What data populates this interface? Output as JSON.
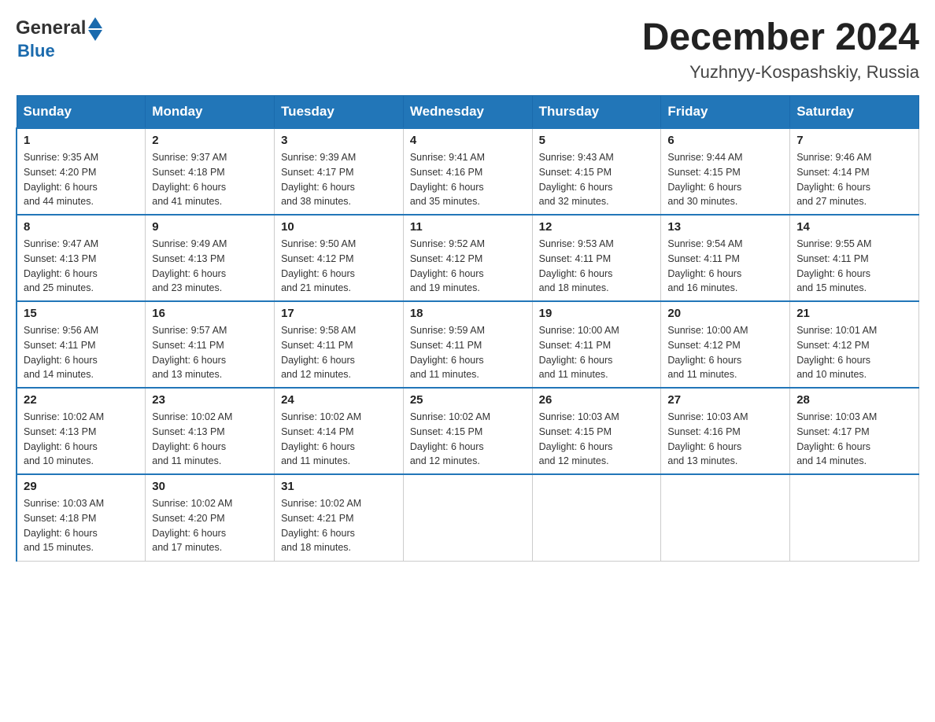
{
  "header": {
    "title": "December 2024",
    "subtitle": "Yuzhnyy-Kospashskiy, Russia",
    "logo_general": "General",
    "logo_blue": "Blue"
  },
  "days_of_week": [
    "Sunday",
    "Monday",
    "Tuesday",
    "Wednesday",
    "Thursday",
    "Friday",
    "Saturday"
  ],
  "weeks": [
    [
      {
        "day": "1",
        "sunrise": "Sunrise: 9:35 AM",
        "sunset": "Sunset: 4:20 PM",
        "daylight": "Daylight: 6 hours",
        "minutes": "and 44 minutes."
      },
      {
        "day": "2",
        "sunrise": "Sunrise: 9:37 AM",
        "sunset": "Sunset: 4:18 PM",
        "daylight": "Daylight: 6 hours",
        "minutes": "and 41 minutes."
      },
      {
        "day": "3",
        "sunrise": "Sunrise: 9:39 AM",
        "sunset": "Sunset: 4:17 PM",
        "daylight": "Daylight: 6 hours",
        "minutes": "and 38 minutes."
      },
      {
        "day": "4",
        "sunrise": "Sunrise: 9:41 AM",
        "sunset": "Sunset: 4:16 PM",
        "daylight": "Daylight: 6 hours",
        "minutes": "and 35 minutes."
      },
      {
        "day": "5",
        "sunrise": "Sunrise: 9:43 AM",
        "sunset": "Sunset: 4:15 PM",
        "daylight": "Daylight: 6 hours",
        "minutes": "and 32 minutes."
      },
      {
        "day": "6",
        "sunrise": "Sunrise: 9:44 AM",
        "sunset": "Sunset: 4:15 PM",
        "daylight": "Daylight: 6 hours",
        "minutes": "and 30 minutes."
      },
      {
        "day": "7",
        "sunrise": "Sunrise: 9:46 AM",
        "sunset": "Sunset: 4:14 PM",
        "daylight": "Daylight: 6 hours",
        "minutes": "and 27 minutes."
      }
    ],
    [
      {
        "day": "8",
        "sunrise": "Sunrise: 9:47 AM",
        "sunset": "Sunset: 4:13 PM",
        "daylight": "Daylight: 6 hours",
        "minutes": "and 25 minutes."
      },
      {
        "day": "9",
        "sunrise": "Sunrise: 9:49 AM",
        "sunset": "Sunset: 4:13 PM",
        "daylight": "Daylight: 6 hours",
        "minutes": "and 23 minutes."
      },
      {
        "day": "10",
        "sunrise": "Sunrise: 9:50 AM",
        "sunset": "Sunset: 4:12 PM",
        "daylight": "Daylight: 6 hours",
        "minutes": "and 21 minutes."
      },
      {
        "day": "11",
        "sunrise": "Sunrise: 9:52 AM",
        "sunset": "Sunset: 4:12 PM",
        "daylight": "Daylight: 6 hours",
        "minutes": "and 19 minutes."
      },
      {
        "day": "12",
        "sunrise": "Sunrise: 9:53 AM",
        "sunset": "Sunset: 4:11 PM",
        "daylight": "Daylight: 6 hours",
        "minutes": "and 18 minutes."
      },
      {
        "day": "13",
        "sunrise": "Sunrise: 9:54 AM",
        "sunset": "Sunset: 4:11 PM",
        "daylight": "Daylight: 6 hours",
        "minutes": "and 16 minutes."
      },
      {
        "day": "14",
        "sunrise": "Sunrise: 9:55 AM",
        "sunset": "Sunset: 4:11 PM",
        "daylight": "Daylight: 6 hours",
        "minutes": "and 15 minutes."
      }
    ],
    [
      {
        "day": "15",
        "sunrise": "Sunrise: 9:56 AM",
        "sunset": "Sunset: 4:11 PM",
        "daylight": "Daylight: 6 hours",
        "minutes": "and 14 minutes."
      },
      {
        "day": "16",
        "sunrise": "Sunrise: 9:57 AM",
        "sunset": "Sunset: 4:11 PM",
        "daylight": "Daylight: 6 hours",
        "minutes": "and 13 minutes."
      },
      {
        "day": "17",
        "sunrise": "Sunrise: 9:58 AM",
        "sunset": "Sunset: 4:11 PM",
        "daylight": "Daylight: 6 hours",
        "minutes": "and 12 minutes."
      },
      {
        "day": "18",
        "sunrise": "Sunrise: 9:59 AM",
        "sunset": "Sunset: 4:11 PM",
        "daylight": "Daylight: 6 hours",
        "minutes": "and 11 minutes."
      },
      {
        "day": "19",
        "sunrise": "Sunrise: 10:00 AM",
        "sunset": "Sunset: 4:11 PM",
        "daylight": "Daylight: 6 hours",
        "minutes": "and 11 minutes."
      },
      {
        "day": "20",
        "sunrise": "Sunrise: 10:00 AM",
        "sunset": "Sunset: 4:12 PM",
        "daylight": "Daylight: 6 hours",
        "minutes": "and 11 minutes."
      },
      {
        "day": "21",
        "sunrise": "Sunrise: 10:01 AM",
        "sunset": "Sunset: 4:12 PM",
        "daylight": "Daylight: 6 hours",
        "minutes": "and 10 minutes."
      }
    ],
    [
      {
        "day": "22",
        "sunrise": "Sunrise: 10:02 AM",
        "sunset": "Sunset: 4:13 PM",
        "daylight": "Daylight: 6 hours",
        "minutes": "and 10 minutes."
      },
      {
        "day": "23",
        "sunrise": "Sunrise: 10:02 AM",
        "sunset": "Sunset: 4:13 PM",
        "daylight": "Daylight: 6 hours",
        "minutes": "and 11 minutes."
      },
      {
        "day": "24",
        "sunrise": "Sunrise: 10:02 AM",
        "sunset": "Sunset: 4:14 PM",
        "daylight": "Daylight: 6 hours",
        "minutes": "and 11 minutes."
      },
      {
        "day": "25",
        "sunrise": "Sunrise: 10:02 AM",
        "sunset": "Sunset: 4:15 PM",
        "daylight": "Daylight: 6 hours",
        "minutes": "and 12 minutes."
      },
      {
        "day": "26",
        "sunrise": "Sunrise: 10:03 AM",
        "sunset": "Sunset: 4:15 PM",
        "daylight": "Daylight: 6 hours",
        "minutes": "and 12 minutes."
      },
      {
        "day": "27",
        "sunrise": "Sunrise: 10:03 AM",
        "sunset": "Sunset: 4:16 PM",
        "daylight": "Daylight: 6 hours",
        "minutes": "and 13 minutes."
      },
      {
        "day": "28",
        "sunrise": "Sunrise: 10:03 AM",
        "sunset": "Sunset: 4:17 PM",
        "daylight": "Daylight: 6 hours",
        "minutes": "and 14 minutes."
      }
    ],
    [
      {
        "day": "29",
        "sunrise": "Sunrise: 10:03 AM",
        "sunset": "Sunset: 4:18 PM",
        "daylight": "Daylight: 6 hours",
        "minutes": "and 15 minutes."
      },
      {
        "day": "30",
        "sunrise": "Sunrise: 10:02 AM",
        "sunset": "Sunset: 4:20 PM",
        "daylight": "Daylight: 6 hours",
        "minutes": "and 17 minutes."
      },
      {
        "day": "31",
        "sunrise": "Sunrise: 10:02 AM",
        "sunset": "Sunset: 4:21 PM",
        "daylight": "Daylight: 6 hours",
        "minutes": "and 18 minutes."
      },
      null,
      null,
      null,
      null
    ]
  ]
}
